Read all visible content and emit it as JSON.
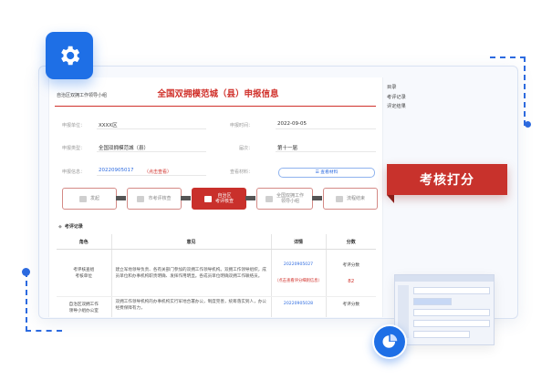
{
  "header": {
    "org": "自治区双拥工作领导小组",
    "title": "全国双拥模范城（县）申报信息"
  },
  "fields": {
    "unit_label": "申报单位：",
    "unit_value": "XXXX区",
    "time_label": "申报时间：",
    "time_value": "2022-09-05",
    "type_label": "申报类型：",
    "type_value": "全国双拥模范城（县）",
    "batch_label": "届次：",
    "batch_value": "第十一届",
    "info_label": "申报信息：",
    "info_value": "20220905017",
    "info_action": "（点击查看）",
    "material_label": "查看材料：",
    "material_button": "☰ 查看材料"
  },
  "steps": [
    {
      "label": "发起"
    },
    {
      "label": "市考评核查"
    },
    {
      "label": "自治区\n考评核查"
    },
    {
      "label": "全国双拥工作\n领导小组"
    },
    {
      "label": "流程结束"
    }
  ],
  "records": {
    "section_title": "考评记录",
    "headers": {
      "role": "角色",
      "opinion": "意见",
      "detail": "详情",
      "score": "分数"
    },
    "rows": [
      {
        "role": "考评核查组\n考核单位",
        "opinion": "建立军地领导负责、各有关部门参加的双拥工作领导机构。双拥工作领导组织，成员单位和办事机构职责明确、发挥作用明显。各成员单位明确双拥工作联络员。",
        "detail_id": "20220905027",
        "detail_action": "（点击查看评分细则信息）",
        "score_label": "考评分数",
        "score_value": "82"
      },
      {
        "role": "自治区双拥工作\n领导小组办公室",
        "opinion": "双拥工作领导机构的办事机构实行军地合署办公，制度完善，统筹落实到人，办公经费保障有力，",
        "detail_id": "20220905028",
        "detail_action": "",
        "score_label": "考评分数",
        "score_value": ""
      }
    ]
  },
  "side_menu": [
    "目录",
    "考评记录",
    "评定结果"
  ],
  "banner": "考核打分",
  "colors": {
    "primary": "#1e6fe6",
    "accent_red": "#c8322c"
  },
  "icons": {
    "badge_top": "gear-icon",
    "badge_bottom": "pie-chart-icon"
  }
}
